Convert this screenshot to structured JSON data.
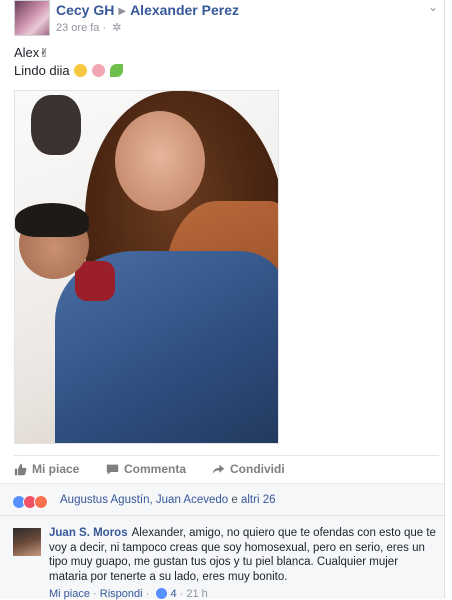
{
  "post": {
    "author": "Cecy GH",
    "target": "Alexander Perez",
    "time": "23 ore fa",
    "privacy_icon": "gear-icon",
    "text_line1": "Alex",
    "text_line2": "Lindo diia"
  },
  "actions": {
    "like": "Mi piace",
    "comment": "Commenta",
    "share": "Condividi"
  },
  "reactions": {
    "names": "Augustus Agustín, Juan Acevedo",
    "and": "e",
    "others": "altri 26",
    "icons": [
      "like-reaction-icon",
      "love-reaction-icon",
      "angry-reaction-icon"
    ]
  },
  "comment": {
    "author": "Juan S. Moros",
    "text": "Alexander, amigo, no quiero que te ofendas con esto que te voy a decir, ni tampoco creas que soy homosexual, pero en serio, eres un tipo muy guapo, me gustan tus ojos y tu piel blanca. Cualquier mujer mataria por tenerte a su lado, eres muy bonito.",
    "like": "Mi piace",
    "reply": "Rispondi",
    "like_count": "4",
    "time": "21 h"
  },
  "colors": {
    "link": "#365899",
    "muted": "#90949c",
    "like_blue": "#5890ff"
  }
}
